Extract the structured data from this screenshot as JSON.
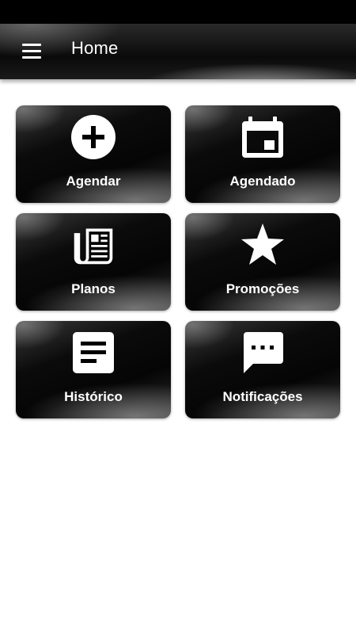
{
  "app_bar": {
    "title": "Home",
    "menu_icon": "hamburger-menu-icon"
  },
  "tiles": [
    {
      "label": "Agendar",
      "icon": "add-circle-icon"
    },
    {
      "label": "Agendado",
      "icon": "calendar-icon"
    },
    {
      "label": "Planos",
      "icon": "newspaper-icon"
    },
    {
      "label": "Promoções",
      "icon": "star-icon"
    },
    {
      "label": "Histórico",
      "icon": "document-icon"
    },
    {
      "label": "Notificações",
      "icon": "chat-bubble-icon"
    }
  ]
}
